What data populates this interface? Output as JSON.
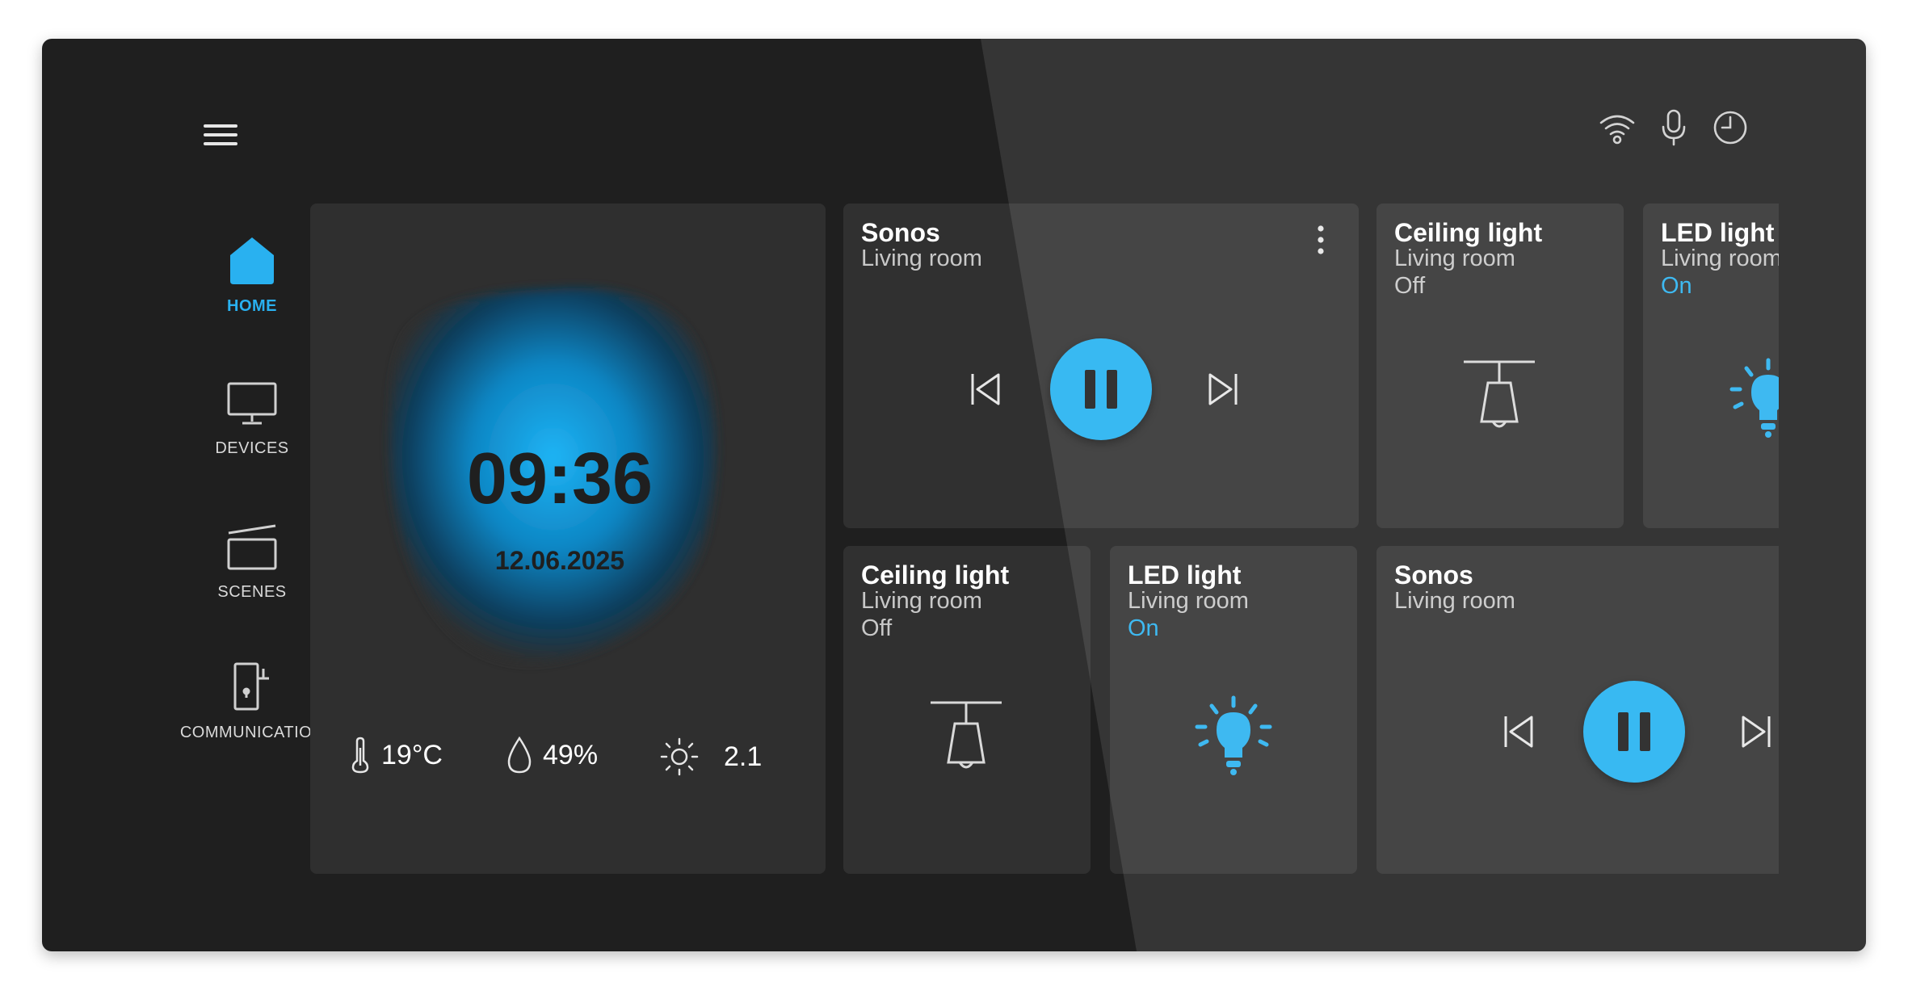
{
  "nav": {
    "items": [
      {
        "label": "HOME",
        "icon": "home-icon",
        "active": true
      },
      {
        "label": "DEVICES",
        "icon": "monitor-icon"
      },
      {
        "label": "SCENES",
        "icon": "scenes-icon"
      },
      {
        "label": "COMMUNICATION",
        "icon": "door-phone-icon"
      }
    ]
  },
  "statusbar": {
    "icons": [
      "menu-icon",
      "wifi-icon",
      "microphone-icon",
      "clock-icon"
    ]
  },
  "clock": {
    "time": "09:36",
    "date": "12.06.2025"
  },
  "weather": {
    "temperature": "19°C",
    "humidity": "49%",
    "uv_index": "2.1"
  },
  "tiles": {
    "sonos_top": {
      "title": "Sonos",
      "room": "Living room"
    },
    "ceiling_top": {
      "title": "Ceiling light",
      "room": "Living room",
      "state": "Off"
    },
    "led_top": {
      "title": "LED light",
      "room": "Living room",
      "state": "On"
    },
    "ceiling_bottom": {
      "title": "Ceiling light",
      "room": "Living room",
      "state": "Off"
    },
    "led_bottom": {
      "title": "LED light",
      "room": "Living room",
      "state": "On"
    },
    "sonos_bottom": {
      "title": "Sonos",
      "room": "Living room"
    }
  },
  "colors": {
    "accent": "#29b1f0",
    "tile": "#303030",
    "screen": "#272727",
    "bezel": "#1f1f1f"
  }
}
